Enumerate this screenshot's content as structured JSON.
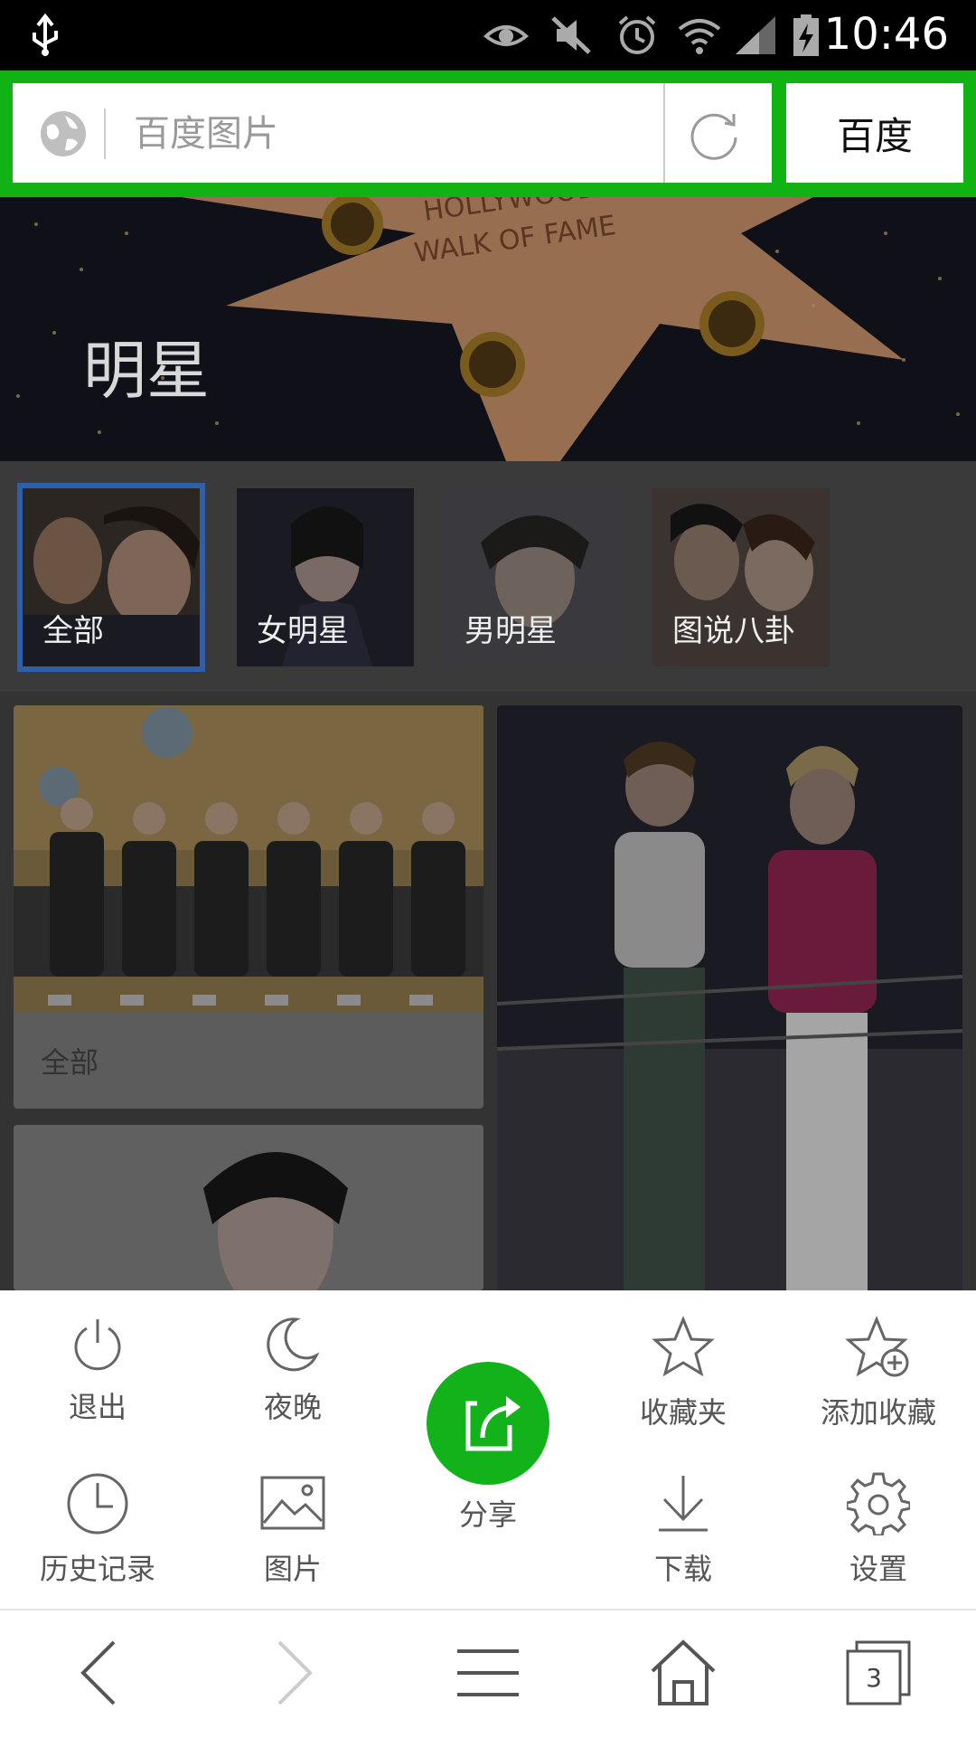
{
  "status_bar": {
    "time": "10:46",
    "icons": [
      "usb-icon",
      "eye-icon",
      "mute-icon",
      "alarm-icon",
      "wifi-icon",
      "signal-icon",
      "battery-charging-icon"
    ]
  },
  "address_bar": {
    "url_text": "百度图片",
    "go_button_label": "百度"
  },
  "banner": {
    "title": "明星"
  },
  "categories": [
    {
      "label": "全部",
      "active": true
    },
    {
      "label": "女明星",
      "active": false
    },
    {
      "label": "男明星",
      "active": false
    },
    {
      "label": "图说八卦",
      "active": false
    }
  ],
  "grid": {
    "cards": [
      {
        "caption": "全部"
      }
    ]
  },
  "menu": {
    "items": [
      {
        "label": "退出",
        "icon": "power-icon"
      },
      {
        "label": "夜晚",
        "icon": "moon-icon"
      },
      {
        "label": "分享",
        "icon": "share-icon"
      },
      {
        "label": "收藏夹",
        "icon": "star-icon"
      },
      {
        "label": "添加收藏",
        "icon": "star-plus-icon"
      },
      {
        "label": "历史记录",
        "icon": "clock-icon"
      },
      {
        "label": "图片",
        "icon": "image-icon"
      },
      {
        "label": "下载",
        "icon": "download-icon"
      },
      {
        "label": "设置",
        "icon": "gear-icon"
      }
    ]
  },
  "nav_bar": {
    "tab_count": "3"
  },
  "colors": {
    "accent_green": "#11b214",
    "active_border": "#2f5fa8"
  }
}
